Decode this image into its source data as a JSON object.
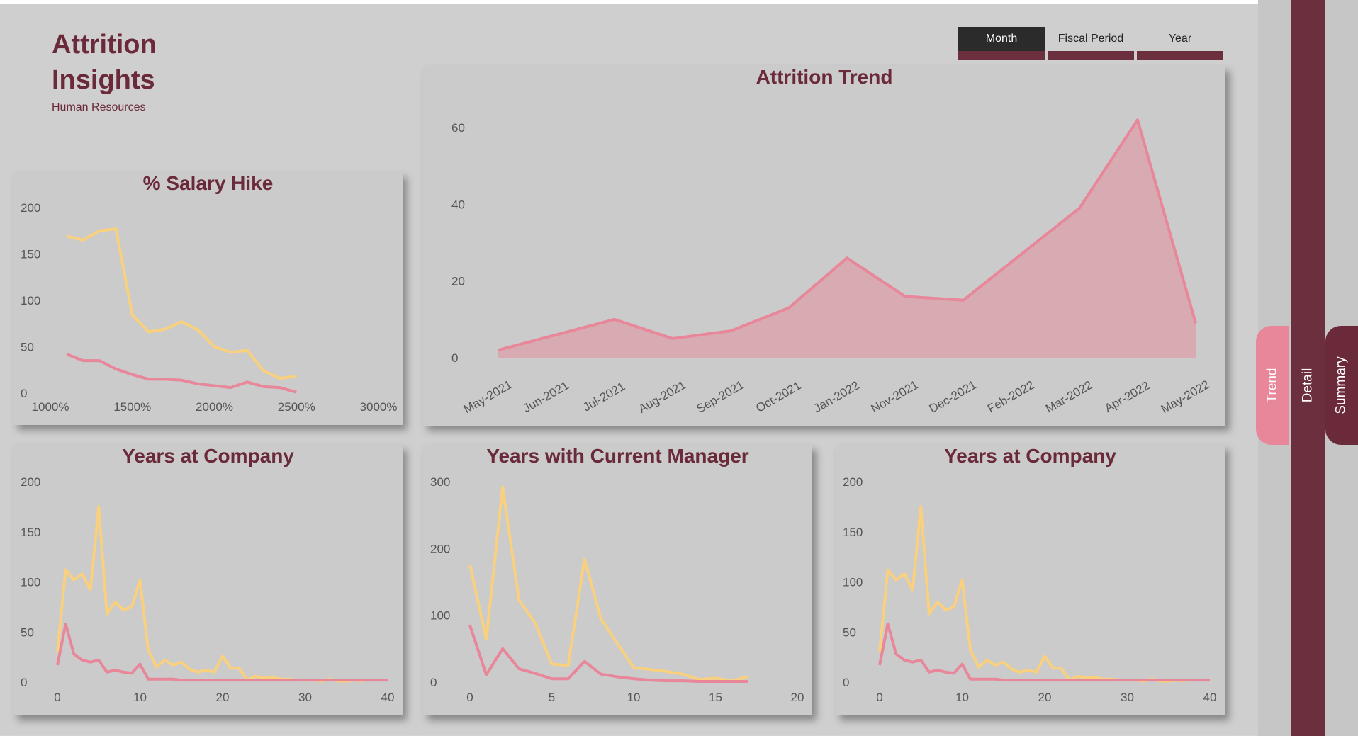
{
  "header": {
    "title_line1": "Attrition",
    "title_line2": "Insights",
    "subtitle": "Human Resources"
  },
  "date_slicer": {
    "options": [
      "Month",
      "Fiscal Period",
      "Year"
    ],
    "selected": "Month"
  },
  "side_tabs": [
    "Trend",
    "Detail",
    "Summary"
  ],
  "colors": {
    "attrition_yes": "#e8879a",
    "attrition_no": "#f9d07e",
    "accent": "#6b2a3a",
    "area_fill": "#d8aab2"
  },
  "chart_data": [
    {
      "id": "attrition-trend",
      "type": "area",
      "title": "Attrition Trend",
      "categories": [
        "May-2021",
        "Jun-2021",
        "Jul-2021",
        "Aug-2021",
        "Sep-2021",
        "Oct-2021",
        "Jan-2022",
        "Nov-2021",
        "Dec-2021",
        "Feb-2022",
        "Mar-2022",
        "Apr-2022",
        "May-2022"
      ],
      "series": [
        {
          "values": [
            2,
            6,
            10,
            5,
            7,
            13,
            26,
            16,
            15,
            27,
            39,
            62,
            9
          ]
        }
      ],
      "ylim": [
        0,
        65
      ],
      "yticks": [
        0,
        20,
        40,
        60
      ],
      "grid": false
    },
    {
      "id": "salary-hike",
      "type": "line",
      "title": "% Salary Hike",
      "xlim": [
        1000,
        3000
      ],
      "xticks": [
        "1000%",
        "1500%",
        "2000%",
        "2500%",
        "3000%"
      ],
      "xtick_values": [
        1000,
        1500,
        2000,
        2500,
        3000
      ],
      "ylim": [
        0,
        200
      ],
      "yticks": [
        0,
        50,
        100,
        150,
        200
      ],
      "series": [
        {
          "color": "#f9d07e",
          "x": [
            1100,
            1200,
            1300,
            1400,
            1500,
            1600,
            1700,
            1800,
            1900,
            2000,
            2100,
            2200,
            2300,
            2400,
            2500
          ],
          "y": [
            169,
            165,
            175,
            177,
            84,
            66,
            69,
            77,
            68,
            50,
            44,
            46,
            24,
            16,
            18
          ]
        },
        {
          "color": "#e8879a",
          "x": [
            1100,
            1200,
            1300,
            1400,
            1500,
            1600,
            1700,
            1800,
            1900,
            2000,
            2100,
            2200,
            2300,
            2400,
            2500
          ],
          "y": [
            42,
            35,
            35,
            26,
            20,
            15,
            15,
            14,
            10,
            8,
            6,
            12,
            7,
            6,
            1
          ]
        }
      ]
    },
    {
      "id": "years-at-company-1",
      "type": "line",
      "title": "Years at Company",
      "xlim": [
        0,
        40
      ],
      "xticks": [
        0,
        10,
        20,
        30,
        40
      ],
      "ylim": [
        0,
        200
      ],
      "yticks": [
        0,
        50,
        100,
        150,
        200
      ],
      "series": [
        {
          "color": "#f9d07e",
          "x": [
            0,
            1,
            2,
            3,
            4,
            5,
            6,
            7,
            8,
            9,
            10,
            11,
            12,
            13,
            14,
            15,
            16,
            17,
            18,
            19,
            20,
            21,
            22,
            23,
            24,
            25,
            26,
            27,
            28,
            29,
            30,
            31,
            32,
            33,
            34,
            35,
            36,
            37
          ],
          "y": [
            30,
            112,
            102,
            108,
            92,
            175,
            68,
            80,
            72,
            75,
            102,
            32,
            15,
            22,
            17,
            20,
            13,
            10,
            12,
            10,
            26,
            14,
            14,
            2,
            6,
            4,
            5,
            3,
            3,
            2,
            2,
            2,
            1,
            3,
            1,
            1,
            2,
            1
          ]
        },
        {
          "color": "#e8879a",
          "x": [
            0,
            1,
            2,
            3,
            4,
            5,
            6,
            7,
            8,
            9,
            10,
            11,
            12,
            13,
            14,
            15,
            16,
            17,
            18,
            19,
            20,
            21,
            22,
            23,
            24,
            25,
            26,
            27,
            28,
            29,
            30,
            31,
            32,
            33,
            34,
            35,
            36,
            37,
            38,
            39,
            40
          ],
          "y": [
            17,
            58,
            28,
            22,
            20,
            22,
            10,
            12,
            10,
            9,
            18,
            3,
            3,
            3,
            3,
            2,
            2,
            2,
            2,
            2,
            2,
            2,
            2,
            2,
            2,
            2,
            2,
            2,
            2,
            2,
            2,
            2,
            2,
            2,
            2,
            2,
            2,
            2,
            2,
            2,
            2
          ]
        }
      ]
    },
    {
      "id": "years-with-current-manager",
      "type": "line",
      "title": "Years with Current Manager",
      "xlim": [
        0,
        20
      ],
      "xticks": [
        0,
        5,
        10,
        15,
        20
      ],
      "ylim": [
        0,
        300
      ],
      "yticks": [
        0,
        100,
        200,
        300
      ],
      "series": [
        {
          "color": "#f9d07e",
          "x": [
            0,
            1,
            2,
            3,
            4,
            5,
            6,
            7,
            8,
            9,
            10,
            11,
            12,
            13,
            14,
            15,
            16,
            17
          ],
          "y": [
            176,
            64,
            292,
            123,
            88,
            27,
            25,
            184,
            95,
            58,
            22,
            19,
            16,
            12,
            4,
            6,
            2,
            8
          ]
        },
        {
          "color": "#e8879a",
          "x": [
            0,
            1,
            2,
            3,
            4,
            5,
            6,
            7,
            8,
            9,
            10,
            11,
            12,
            13,
            14,
            15,
            16,
            17
          ],
          "y": [
            85,
            11,
            50,
            20,
            13,
            5,
            5,
            31,
            12,
            8,
            5,
            3,
            2,
            2,
            1,
            1,
            1,
            1
          ]
        }
      ]
    },
    {
      "id": "years-at-company-2",
      "type": "line",
      "title": "Years at Company",
      "xlim": [
        0,
        40
      ],
      "xticks": [
        0,
        10,
        20,
        30,
        40
      ],
      "ylim": [
        0,
        200
      ],
      "yticks": [
        0,
        50,
        100,
        150,
        200
      ],
      "series": [
        {
          "color": "#f9d07e",
          "x": [
            0,
            1,
            2,
            3,
            4,
            5,
            6,
            7,
            8,
            9,
            10,
            11,
            12,
            13,
            14,
            15,
            16,
            17,
            18,
            19,
            20,
            21,
            22,
            23,
            24,
            25,
            26,
            27,
            28,
            29,
            30,
            31,
            32,
            33,
            34,
            35,
            36,
            37
          ],
          "y": [
            30,
            112,
            102,
            108,
            92,
            175,
            68,
            80,
            72,
            75,
            102,
            32,
            15,
            22,
            17,
            20,
            13,
            10,
            12,
            10,
            26,
            14,
            14,
            2,
            6,
            4,
            5,
            3,
            3,
            2,
            2,
            2,
            1,
            3,
            1,
            1,
            2,
            1
          ]
        },
        {
          "color": "#e8879a",
          "x": [
            0,
            1,
            2,
            3,
            4,
            5,
            6,
            7,
            8,
            9,
            10,
            11,
            12,
            13,
            14,
            15,
            16,
            17,
            18,
            19,
            20,
            21,
            22,
            23,
            24,
            25,
            26,
            27,
            28,
            29,
            30,
            31,
            32,
            33,
            34,
            35,
            36,
            37,
            38,
            39,
            40
          ],
          "y": [
            17,
            58,
            28,
            22,
            20,
            22,
            10,
            12,
            10,
            9,
            18,
            3,
            3,
            3,
            3,
            2,
            2,
            2,
            2,
            2,
            2,
            2,
            2,
            2,
            2,
            2,
            2,
            2,
            2,
            2,
            2,
            2,
            2,
            2,
            2,
            2,
            2,
            2,
            2,
            2,
            2
          ]
        }
      ]
    }
  ]
}
